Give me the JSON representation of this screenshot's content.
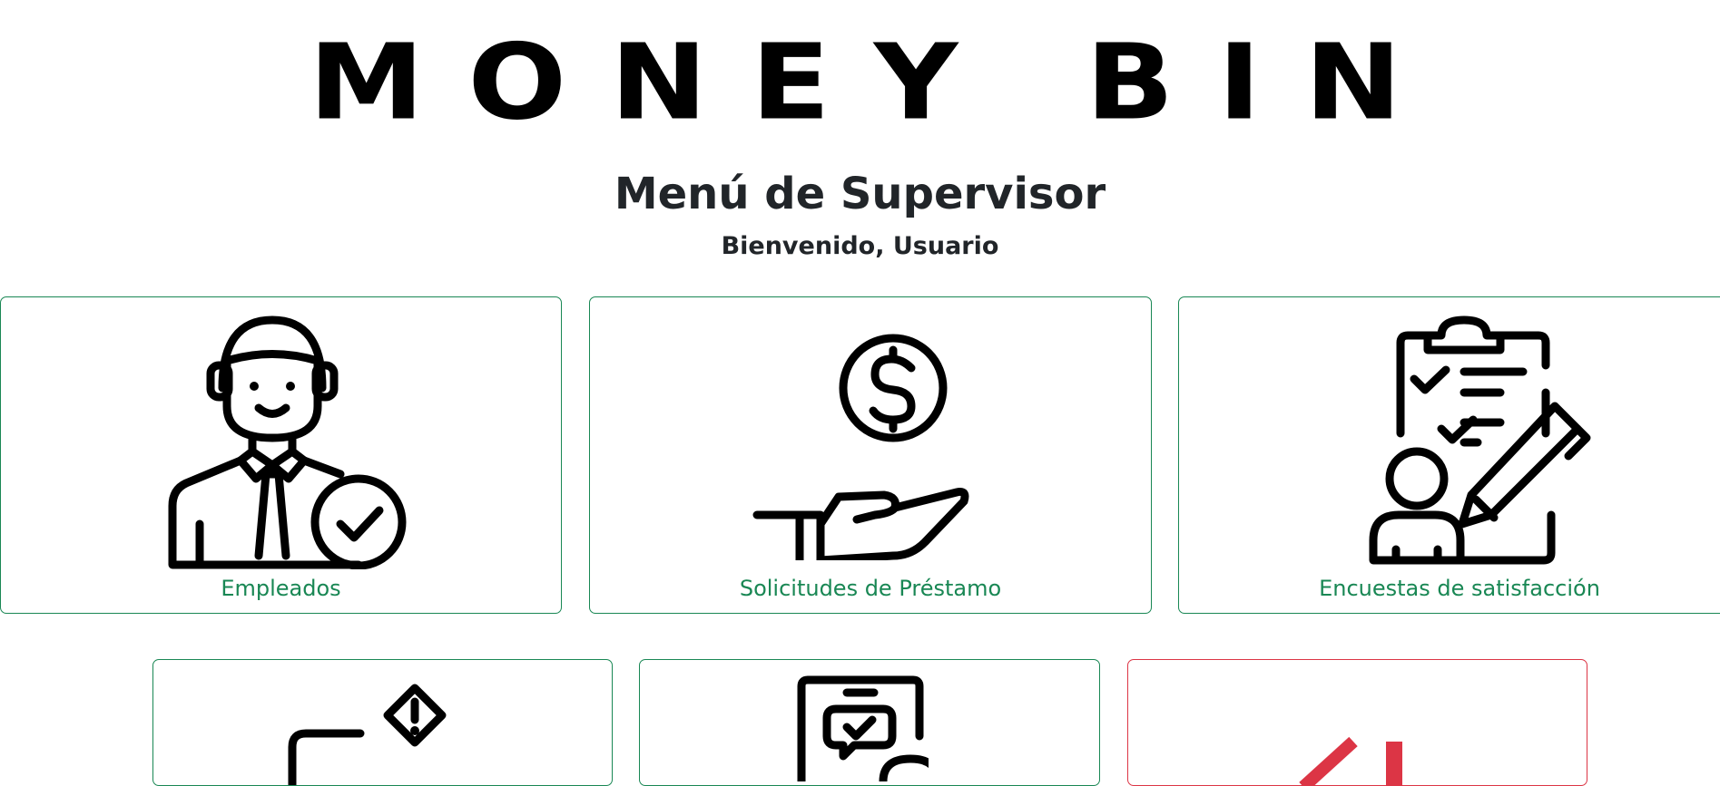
{
  "brand": {
    "logo_text": "MONEY BIN"
  },
  "header": {
    "title": "Menú de Supervisor",
    "greeting": "Bienvenido, Usuario"
  },
  "cards": [
    {
      "label": "Empleados",
      "icon": "employee-check-icon"
    },
    {
      "label": "Solicitudes de Préstamo",
      "icon": "hand-coin-icon"
    },
    {
      "label": "Encuestas de satisfacción",
      "icon": "survey-clipboard-icon"
    },
    {
      "label": "",
      "icon": "alert-window-icon"
    },
    {
      "label": "",
      "icon": "chat-review-icon"
    },
    {
      "label": "",
      "icon": "logout-icon"
    }
  ],
  "colors": {
    "success": "#198754",
    "danger": "#dc3545",
    "text": "#212529"
  }
}
